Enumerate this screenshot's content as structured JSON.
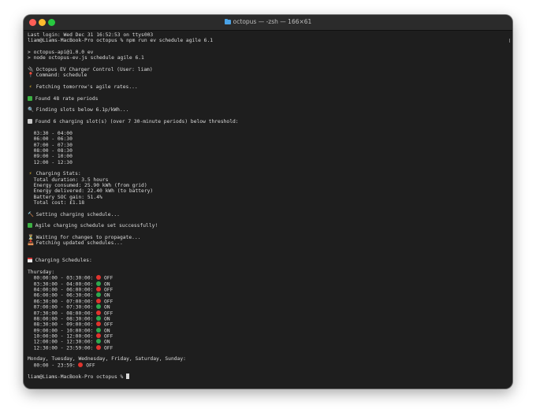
{
  "window": {
    "title": "octopus — -zsh — 166×61",
    "folder_icon": "folder-icon"
  },
  "terminal": {
    "lines": [
      {
        "text": "Last login: Wed Dec 31 16:52:53 on ttys003"
      },
      {
        "text": "liam@Liams-MacBook-Pro octopus % npm run ev schedule agile 6.1"
      },
      {
        "text": ""
      },
      {
        "text": "> octopus-api@1.0.0 ev"
      },
      {
        "text": "> node octopus-ev.js schedule agile 6.1"
      },
      {
        "text": ""
      },
      {
        "icon": "plug",
        "text": " Octopus EV Charger Control (User: liam)"
      },
      {
        "icon": "pin",
        "text": " Command: schedule"
      },
      {
        "text": ""
      },
      {
        "icon": "bolt",
        "text": " Fetching tomorrow's agile rates..."
      },
      {
        "text": ""
      },
      {
        "icon": "check",
        "text": " Found 48 rate periods"
      },
      {
        "text": ""
      },
      {
        "icon": "mag",
        "text": " Finding slots below 6.1p/kWh..."
      },
      {
        "text": ""
      },
      {
        "icon": "chart",
        "text": " Found 6 charging slot(s) (over 7 30-minute periods) below threshold:"
      },
      {
        "text": ""
      },
      {
        "text": "  03:30 - 04:00"
      },
      {
        "text": "  06:00 - 06:30"
      },
      {
        "text": "  07:00 - 07:30"
      },
      {
        "text": "  08:00 - 08:30"
      },
      {
        "text": "  09:00 - 10:00"
      },
      {
        "text": "  12:00 - 12:30"
      },
      {
        "text": ""
      },
      {
        "icon": "bolt",
        "text": " Charging Stats:"
      },
      {
        "text": "  Total duration: 3.5 hours"
      },
      {
        "text": "  Energy consumed: 25.90 kWh (from grid)"
      },
      {
        "text": "  Energy delivered: 22.40 kWh (to battery)"
      },
      {
        "text": "  Battery SOC gain: 51.4%"
      },
      {
        "text": "  Total cost: £1.18"
      },
      {
        "text": ""
      },
      {
        "icon": "hammer",
        "text": " Setting charging schedule..."
      },
      {
        "text": ""
      },
      {
        "icon": "check",
        "text": " Agile charging schedule set successfully!"
      },
      {
        "text": ""
      },
      {
        "icon": "hour",
        "text": " Waiting for changes to propagate..."
      },
      {
        "icon": "inbox",
        "text": " Fetching updated schedules..."
      },
      {
        "text": ""
      },
      {
        "text": ""
      },
      {
        "icon": "cal",
        "text": " Charging Schedules:"
      },
      {
        "text": ""
      },
      {
        "text": "Thursday:"
      },
      {
        "text": "  00:00:00 - 03:30:00: ",
        "dot": "red",
        "after": " OFF"
      },
      {
        "text": "  03:30:00 - 04:00:00: ",
        "dot": "green",
        "after": " ON"
      },
      {
        "text": "  04:00:00 - 06:00:00: ",
        "dot": "red",
        "after": " OFF"
      },
      {
        "text": "  06:00:00 - 06:30:00: ",
        "dot": "green",
        "after": " ON"
      },
      {
        "text": "  06:30:00 - 07:00:00: ",
        "dot": "red",
        "after": " OFF"
      },
      {
        "text": "  07:00:00 - 07:30:00: ",
        "dot": "green",
        "after": " ON"
      },
      {
        "text": "  07:30:00 - 08:00:00: ",
        "dot": "red",
        "after": " OFF"
      },
      {
        "text": "  08:00:00 - 08:30:00: ",
        "dot": "green",
        "after": " ON"
      },
      {
        "text": "  08:30:00 - 09:00:00: ",
        "dot": "red",
        "after": " OFF"
      },
      {
        "text": "  09:00:00 - 10:00:00: ",
        "dot": "green",
        "after": " ON"
      },
      {
        "text": "  10:00:00 - 12:00:00: ",
        "dot": "red",
        "after": " OFF"
      },
      {
        "text": "  12:00:00 - 12:30:00: ",
        "dot": "green",
        "after": " ON"
      },
      {
        "text": "  12:30:00 - 23:59:00: ",
        "dot": "red",
        "after": " OFF"
      },
      {
        "text": ""
      },
      {
        "text": "Monday, Tuesday, Wednesday, Friday, Saturday, Sunday:"
      },
      {
        "text": "  00:00 - 23:59: ",
        "dot": "red",
        "after": " OFF"
      },
      {
        "text": ""
      },
      {
        "text": "liam@Liams-MacBook-Pro octopus % ",
        "cursor": true
      }
    ]
  },
  "colors": {
    "background": "#1e1e1e",
    "text": "#dcdcdc",
    "status_on": "#2fa84f",
    "status_off": "#e0342e"
  }
}
